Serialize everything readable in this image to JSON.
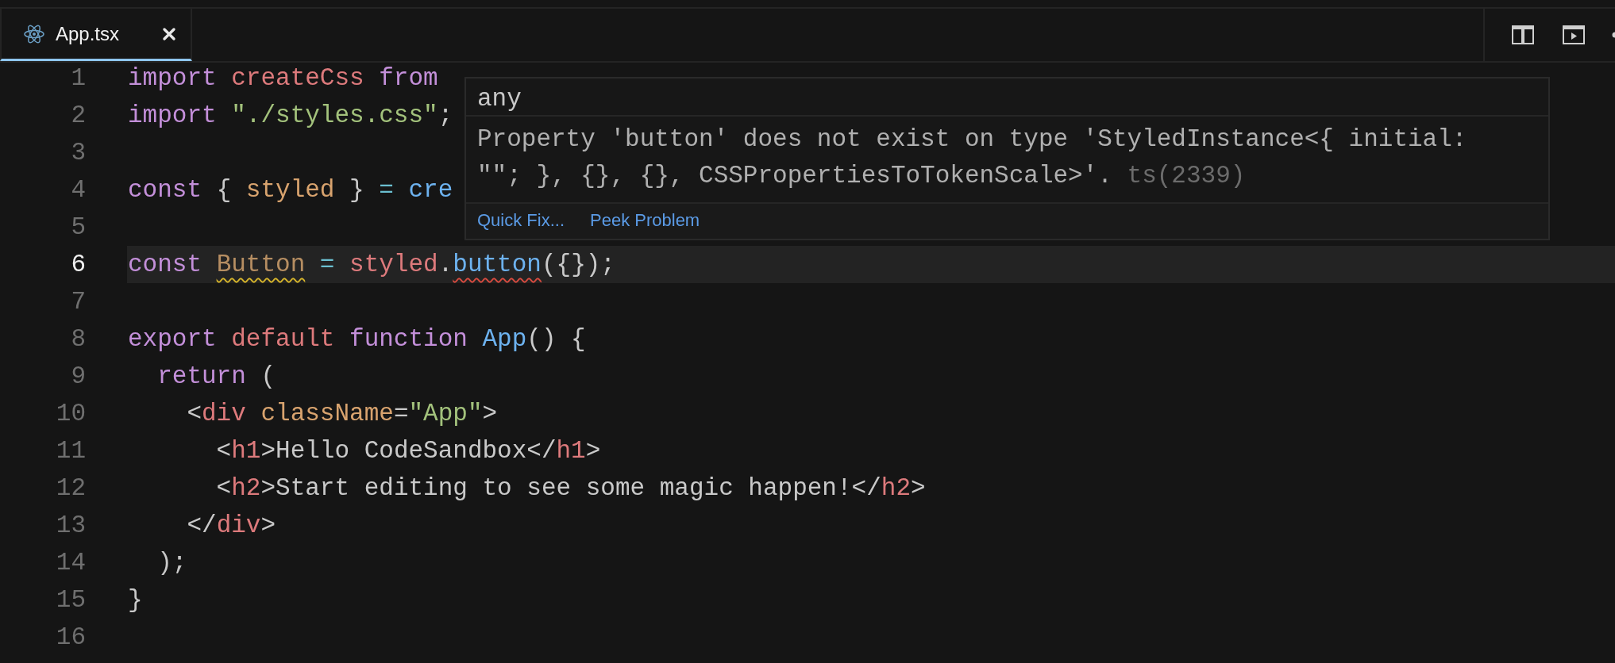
{
  "tabs": [
    {
      "label": "App.tsx",
      "selected": true
    }
  ],
  "editor": {
    "lines": [
      {
        "number": "1",
        "current": false,
        "tokens": [
          {
            "t": "import ",
            "kind": "keyword"
          },
          {
            "t": "createCss ",
            "kind": "name"
          },
          {
            "t": "from",
            "kind": "keyword"
          }
        ]
      },
      {
        "number": "2",
        "current": false,
        "tokens": [
          {
            "t": "import ",
            "kind": "keyword"
          },
          {
            "t": "\"./styles.css\"",
            "kind": "string"
          },
          {
            "t": ";",
            "kind": "plain"
          }
        ]
      },
      {
        "number": "3",
        "current": false
      },
      {
        "number": "4",
        "current": false,
        "tokens": [
          {
            "t": "const ",
            "kind": "keyword"
          },
          {
            "t": "{ ",
            "kind": "plain"
          },
          {
            "t": "styled ",
            "kind": "attr"
          },
          {
            "t": "} ",
            "kind": "plain"
          },
          {
            "t": "= ",
            "kind": "operator"
          },
          {
            "t": "cre",
            "kind": "function"
          }
        ]
      },
      {
        "number": "5",
        "current": false
      },
      {
        "number": "6",
        "current": true,
        "tokens": [
          {
            "t": "const ",
            "kind": "keyword"
          },
          {
            "t": "Button",
            "kind": "class",
            "warning": true
          },
          {
            "t": " = ",
            "kind": "operator"
          },
          {
            "t": "styled",
            "kind": "name"
          },
          {
            "t": ".",
            "kind": "plain"
          },
          {
            "t": "button",
            "kind": "function",
            "error": true
          },
          {
            "t": "({});",
            "kind": "plain"
          }
        ]
      },
      {
        "number": "7",
        "current": false
      },
      {
        "number": "8",
        "current": false,
        "tokens": [
          {
            "t": "export ",
            "kind": "keyword"
          },
          {
            "t": "default ",
            "kind": "name"
          },
          {
            "t": "function ",
            "kind": "keyword"
          },
          {
            "t": "App",
            "kind": "function"
          },
          {
            "t": "() {",
            "kind": "plain"
          }
        ]
      },
      {
        "number": "9",
        "current": false,
        "tokens": [
          {
            "t": "  return",
            "kind": "keyword"
          },
          {
            "t": " (",
            "kind": "plain"
          }
        ]
      },
      {
        "number": "10",
        "current": false,
        "tokens": [
          {
            "t": "    <",
            "kind": "plain"
          },
          {
            "t": "div ",
            "kind": "name"
          },
          {
            "t": "className",
            "kind": "attr"
          },
          {
            "t": "=",
            "kind": "plain"
          },
          {
            "t": "\"App\"",
            "kind": "string"
          },
          {
            "t": ">",
            "kind": "plain"
          }
        ]
      },
      {
        "number": "11",
        "current": false,
        "tokens": [
          {
            "t": "      <",
            "kind": "plain"
          },
          {
            "t": "h1",
            "kind": "name"
          },
          {
            "t": ">Hello CodeSandbox</",
            "kind": "plain"
          },
          {
            "t": "h1",
            "kind": "name"
          },
          {
            "t": ">",
            "kind": "plain"
          }
        ]
      },
      {
        "number": "12",
        "current": false,
        "tokens": [
          {
            "t": "      <",
            "kind": "plain"
          },
          {
            "t": "h2",
            "kind": "name"
          },
          {
            "t": ">Start editing to see some magic happen!</",
            "kind": "plain"
          },
          {
            "t": "h2",
            "kind": "name"
          },
          {
            "t": ">",
            "kind": "plain"
          }
        ]
      },
      {
        "number": "13",
        "current": false,
        "tokens": [
          {
            "t": "    </",
            "kind": "plain"
          },
          {
            "t": "div",
            "kind": "name"
          },
          {
            "t": ">",
            "kind": "plain"
          }
        ]
      },
      {
        "number": "14",
        "current": false,
        "tokens": [
          {
            "t": "  );",
            "kind": "plain"
          }
        ]
      },
      {
        "number": "15",
        "current": false,
        "tokens": [
          {
            "t": "}",
            "kind": "plain"
          }
        ]
      },
      {
        "number": "16",
        "current": false
      }
    ]
  },
  "hover": {
    "type": "any",
    "message": "Property 'button' does not exist on type 'StyledInstance<{ initial: \"\"; }, {}, {}, CSSPropertiesToTokenScale>'.",
    "code": "ts(2339)",
    "actions": [
      "Quick Fix...",
      "Peek Problem"
    ]
  }
}
